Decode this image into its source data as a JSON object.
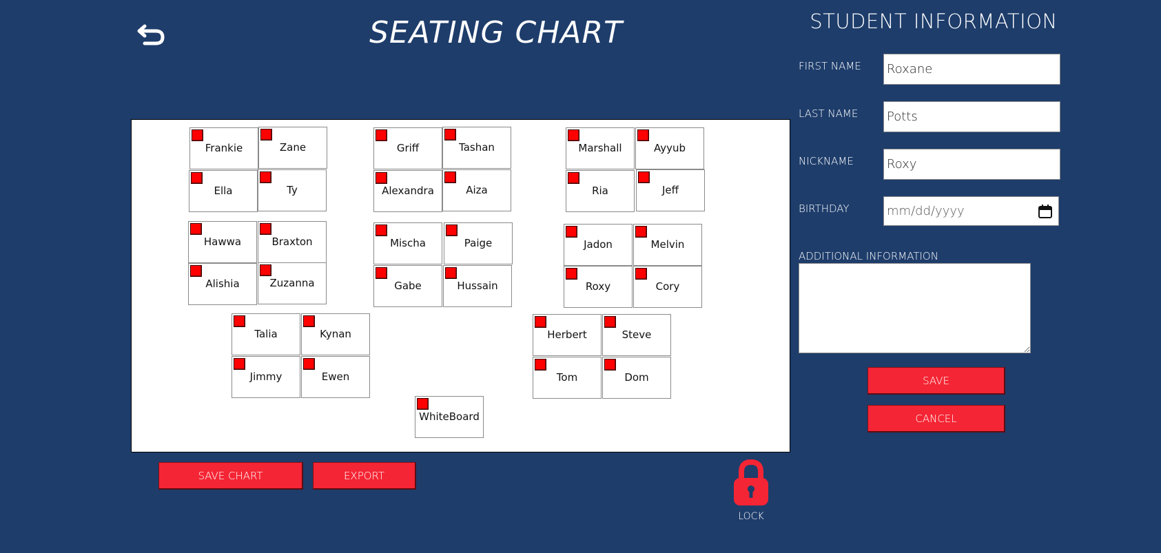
{
  "header": {
    "title": "SEATING CHART"
  },
  "desks": [
    {
      "name": "Frankie"
    },
    {
      "name": "Zane"
    },
    {
      "name": "Ella"
    },
    {
      "name": "Ty"
    },
    {
      "name": "Griff"
    },
    {
      "name": "Tashan"
    },
    {
      "name": "Alexandra"
    },
    {
      "name": "Aiza"
    },
    {
      "name": "Marshall"
    },
    {
      "name": "Ayyub"
    },
    {
      "name": "Ria"
    },
    {
      "name": "Jeff"
    },
    {
      "name": "Hawwa"
    },
    {
      "name": "Braxton"
    },
    {
      "name": "Alishia"
    },
    {
      "name": "Zuzanna"
    },
    {
      "name": "Mischa"
    },
    {
      "name": "Paige"
    },
    {
      "name": "Gabe"
    },
    {
      "name": "Hussain"
    },
    {
      "name": "Jadon"
    },
    {
      "name": "Melvin"
    },
    {
      "name": "Roxy"
    },
    {
      "name": "Cory"
    },
    {
      "name": "Talia"
    },
    {
      "name": "Kynan"
    },
    {
      "name": "Jimmy"
    },
    {
      "name": "Ewen"
    },
    {
      "name": "Herbert"
    },
    {
      "name": "Steve"
    },
    {
      "name": "Tom"
    },
    {
      "name": "Dom"
    },
    {
      "name": "WhiteBoard"
    }
  ],
  "actions": {
    "save_chart": "SAVE CHART",
    "export": "EXPORT",
    "lock": "LOCK"
  },
  "student_info": {
    "title": "STUDENT INFORMATION",
    "first_name_label": "FIRST NAME",
    "first_name": "Roxane",
    "last_name_label": "LAST NAME",
    "last_name": "Potts",
    "nickname_label": "NICKNAME",
    "nickname": "Roxy",
    "birthday_label": "BIRTHDAY",
    "birthday_placeholder": "mm/dd/yyyy",
    "additional_label": "ADDITIONAL INFORMATION",
    "additional": "",
    "save": "SAVE",
    "cancel": "CANCEL"
  },
  "colors": {
    "background": "#1e3d6b",
    "accent_red": "#f42534",
    "handle_red": "#ff0000"
  }
}
